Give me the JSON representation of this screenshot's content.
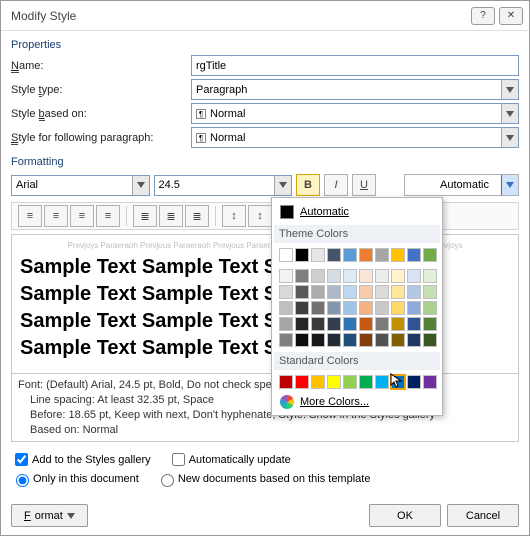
{
  "title": "Modify Style",
  "sections": {
    "properties": "Properties",
    "formatting": "Formatting"
  },
  "labels": {
    "name": "Name:",
    "styleType": "Style type:",
    "basedOn": "Style based on:",
    "following": "Style for following paragraph:"
  },
  "values": {
    "name": "rgTitle",
    "styleType": "Paragraph",
    "basedOn": "Normal",
    "following": "Normal",
    "fontName": "Arial",
    "fontSize": "24.5",
    "colorLabel": "Automatic"
  },
  "preview": {
    "prevPara": "Prevjoys Paraeraoh Prevjous Paraeraoh Prevjous Paraeraoh Prevjous Paraeraoh Prevjous Paraeraoh Prevjoys",
    "sample1": "Sample Text Sample Text Sample Text",
    "sample2": "Sample Text Sample Text Sample Text",
    "sample3": "Sample Text Sample Text Sample Text",
    "sample4": "Sample Text Sample Text Sample Text"
  },
  "description": {
    "l1": "Font: (Default) Arial, 24.5 pt, Bold, Do not check spelling or grammar, Centered",
    "l2": "Line spacing:  At least 32.35 pt, Space",
    "l3": "Before:  18.65 pt, Keep with next, Don't hyphenate, Style: Show in the Styles gallery",
    "l4": "Based on: Normal"
  },
  "checks": {
    "addGallery": "Add to the Styles gallery",
    "autoUpdate": "Automatically update"
  },
  "radios": {
    "onlyDoc": "Only in this document",
    "newDocs": "New documents based on this template"
  },
  "buttons": {
    "format": "Format",
    "ok": "OK",
    "cancel": "Cancel"
  },
  "popup": {
    "automatic": "Automatic",
    "theme": "Theme Colors",
    "standard": "Standard Colors",
    "more": "More Colors...",
    "themeRow1": [
      "#ffffff",
      "#000000",
      "#e7e6e6",
      "#44546a",
      "#5b9bd5",
      "#ed7d31",
      "#a5a5a5",
      "#ffc000",
      "#4472c4",
      "#70ad47"
    ],
    "themeShades": [
      [
        "#f2f2f2",
        "#7f7f7f",
        "#d0cece",
        "#d6dce5",
        "#deebf7",
        "#fbe5d6",
        "#ededed",
        "#fff2cc",
        "#d9e2f3",
        "#e2efda"
      ],
      [
        "#d9d9d9",
        "#595959",
        "#aeabab",
        "#adb9ca",
        "#bdd7ee",
        "#f8cbad",
        "#dbdbdb",
        "#ffe699",
        "#b4c7e7",
        "#c5e0b4"
      ],
      [
        "#bfbfbf",
        "#404040",
        "#757171",
        "#8497b0",
        "#9dc3e6",
        "#f4b183",
        "#c9c9c9",
        "#ffd966",
        "#8faadc",
        "#a9d18e"
      ],
      [
        "#a6a6a6",
        "#262626",
        "#3b3838",
        "#333f50",
        "#2e75b6",
        "#c55a11",
        "#7b7b7b",
        "#bf9000",
        "#2f5597",
        "#548235"
      ],
      [
        "#808080",
        "#0d0d0d",
        "#171717",
        "#222a35",
        "#1f4e79",
        "#843c0c",
        "#525252",
        "#806000",
        "#1f3864",
        "#385723"
      ]
    ],
    "standardColors": [
      "#c00000",
      "#ff0000",
      "#ffc000",
      "#ffff00",
      "#92d050",
      "#00b050",
      "#00b0f0",
      "#0070c0",
      "#002060",
      "#7030a0"
    ],
    "selectedStandardIndex": 7
  }
}
